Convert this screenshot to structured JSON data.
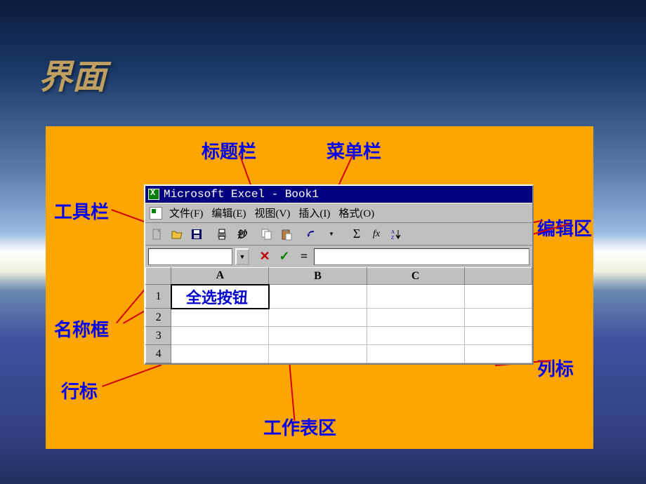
{
  "slide": {
    "title": "界面"
  },
  "annotations": {
    "title_bar": "标题栏",
    "menu_bar": "菜单栏",
    "toolbar": "工具栏",
    "edit_area": "编辑区",
    "name_box": "名称框",
    "col_header": "列标",
    "row_header": "行标",
    "worksheet_area": "工作表区"
  },
  "excel": {
    "title": "Microsoft Excel - Book1",
    "menus": [
      "文件(F)",
      "编辑(E)",
      "视图(V)",
      "插入(I)",
      "格式(O)"
    ],
    "formula_btns": {
      "cancel": "✕",
      "enter": "✓",
      "eq": "="
    },
    "autosum": "Σ",
    "fx": "fx",
    "columns": [
      "A",
      "B",
      "C"
    ],
    "rows": [
      "1",
      "2",
      "3",
      "4"
    ],
    "cell_a1": "全选按钮"
  }
}
